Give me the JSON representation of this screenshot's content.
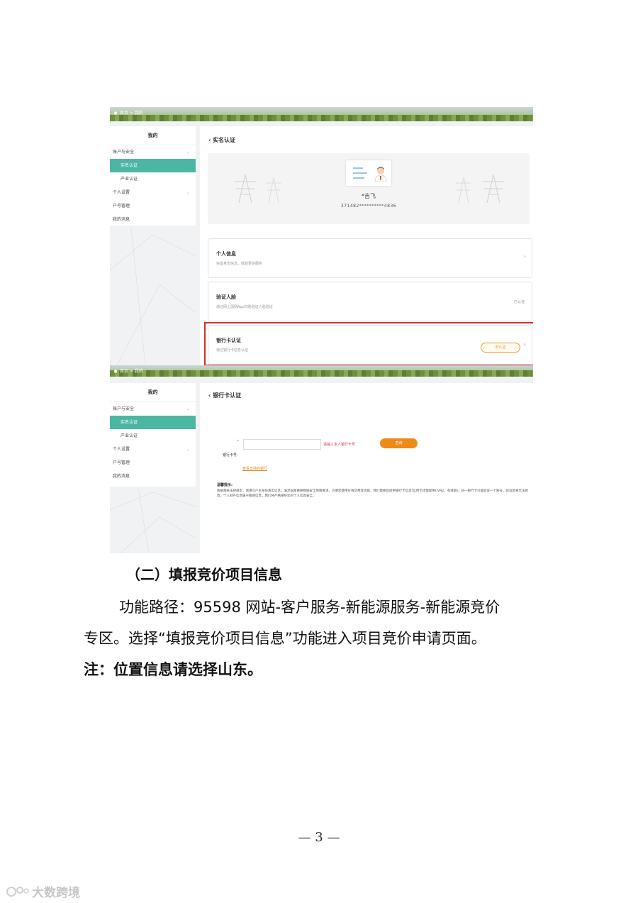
{
  "shot1": {
    "breadcrumb": "首页  >  我的",
    "sidebar": {
      "title": "我的",
      "items": [
        {
          "label": "账户与安全"
        },
        {
          "label": "实名认证"
        },
        {
          "label": "产业认证"
        },
        {
          "label": "个人设置"
        },
        {
          "label": "户号管理"
        },
        {
          "label": "我的消息"
        }
      ]
    },
    "page_title": "实名认证",
    "id_card": {
      "name": "*吉飞",
      "number": "371482**********4836"
    },
    "sections": [
      {
        "title": "个人信息",
        "desc": "完善身份信息，体验更多服务",
        "status": "›"
      },
      {
        "title": "验证人脸",
        "desc": "通过网上国网App扫脸验证人脸验证",
        "status": "已认证"
      },
      {
        "title": "银行卡认证",
        "desc": "通过银行卡信息认证",
        "button": "去认证",
        "status": "›"
      }
    ],
    "highlight_color": "#d92b2b"
  },
  "shot2": {
    "breadcrumb": "首页  >  我的",
    "sidebar": {
      "title": "我的",
      "items": [
        {
          "label": "账户与安全"
        },
        {
          "label": "实名认证"
        },
        {
          "label": "产业认证"
        },
        {
          "label": "个人设置"
        },
        {
          "label": "户号管理"
        },
        {
          "label": "我的消息"
        }
      ]
    },
    "page_title": "银行卡认证",
    "form": {
      "star": "*",
      "hint": "请输入本人银行卡号",
      "query_button": "查询",
      "label": "银行卡号:",
      "link": "查看支持的银行"
    },
    "tips": {
      "title": "温馨提示:",
      "body": "依据相关法律规定，请填写户主身份真实信息，满足国家重要数据安全保障要求，方便您使用在线交费等功能，我们需要您提供银行卡信息(信用卡还需提供CVN2、有效期)，同一银行卡只能验证一个账号，验证后将无法修改。个人财产信息属于敏感信息，我们将严格保护您的个人信息安全。"
    }
  },
  "text": {
    "heading": "（二）填报竞价项目信息",
    "para_line1": "功能路径：95598 网站-客户服务-新能源服务-新能源竞价",
    "para_line2": "专区。选择“填报竞价项目信息”功能进入项目竞价申请页面。",
    "note": "注：位置信息请选择山东。",
    "page_number": "— 3 —"
  },
  "watermark": {
    "text": "大数跨境"
  },
  "colors": {
    "accent": "#4bb7a3",
    "orange": "#ee8a17",
    "red": "#d92b2b"
  }
}
